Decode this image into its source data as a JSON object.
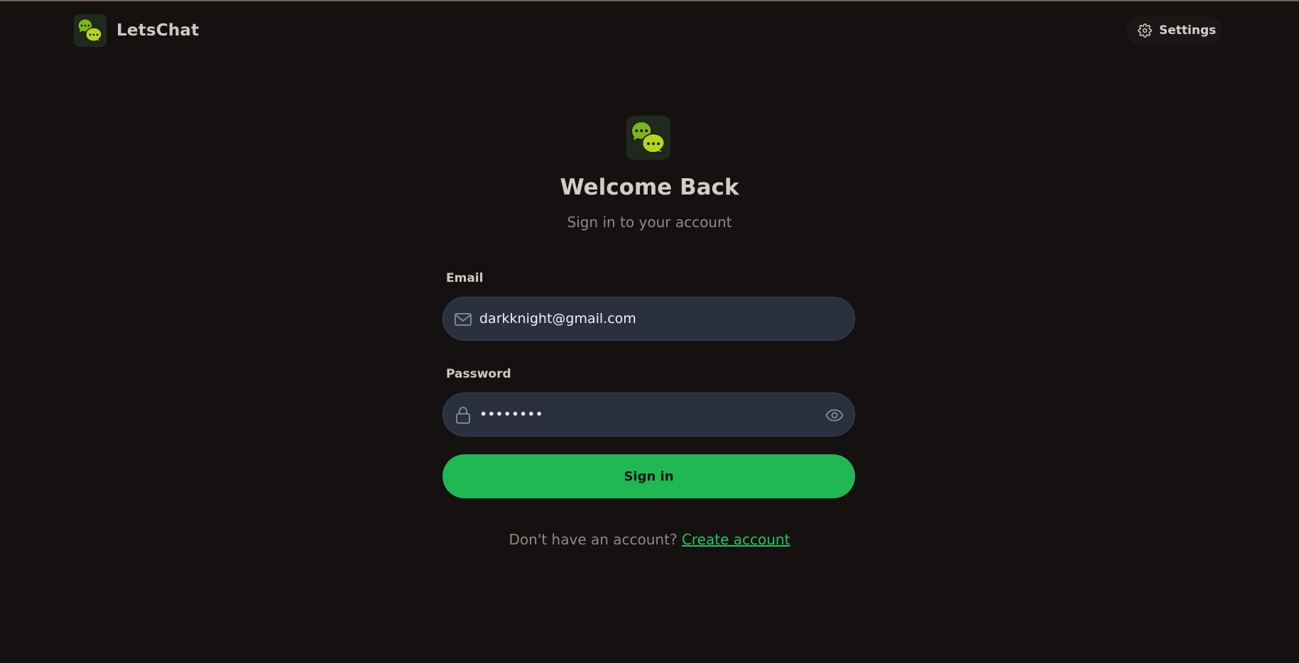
{
  "app": {
    "name": "LetsChat"
  },
  "nav": {
    "settings_label": "Settings",
    "settings_icon": "gear-icon",
    "logo_icon": "chat-bubbles-logo"
  },
  "login": {
    "title": "Welcome Back",
    "subtitle": "Sign in to your account",
    "email_label": "Email",
    "email_value": "darkknight@gmail.com",
    "email_icon": "mail-icon",
    "password_label": "Password",
    "password_value": "darkpass",
    "password_icon": "lock-icon",
    "visibility_icon": "eye-icon",
    "submit_label": "Sign in",
    "footer_text": "Don't have an account?",
    "create_link": "Create account"
  },
  "colors": {
    "background": "#151111",
    "accent": "#22c55e",
    "input_bg": "#2b3040",
    "logo_green": "#7ab51d"
  }
}
